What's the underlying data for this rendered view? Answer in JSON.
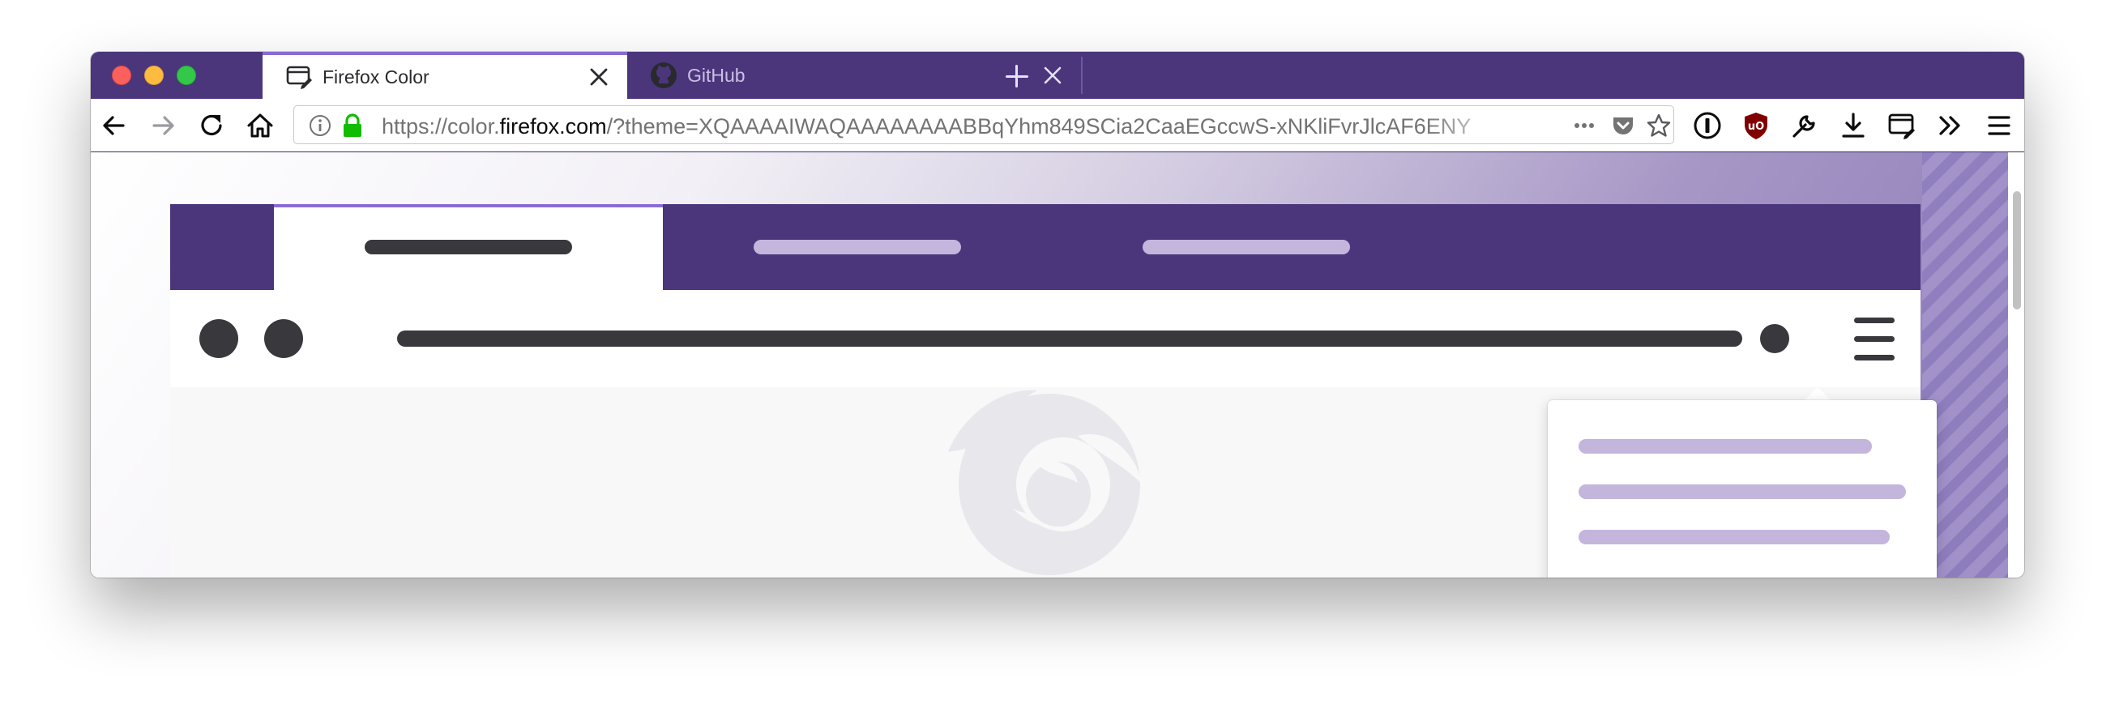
{
  "window": {
    "traffic_lights": [
      "close",
      "minimize",
      "maximize"
    ]
  },
  "tabs": [
    {
      "title": "Firefox Color",
      "icon": "firefox-color-icon",
      "active": true
    },
    {
      "title": "GitHub",
      "icon": "github-icon",
      "active": false
    }
  ],
  "navbar": {
    "buttons": [
      "back-icon",
      "forward-icon",
      "reload-icon",
      "home-icon"
    ],
    "url": {
      "prefix": "https://color.",
      "host": "firefox.com",
      "rest": "/?theme=XQAAAAIWAQAAAAAAAABBqYhm849SCia2CaaEGccwS-xNKliFvrJlcAF6ENY"
    },
    "toolbar_icons": [
      "page-actions-icon",
      "pocket-icon",
      "bookmark-star-icon",
      "onepassword-icon",
      "ublock-origin-icon",
      "developer-tools-icon",
      "downloads-icon",
      "firefox-color-extension-icon",
      "overflow-chevron-icon",
      "hamburger-menu-icon"
    ]
  },
  "colors": {
    "frame": "#4b367c",
    "tab_line": "#8a6cd1",
    "toolbar": "#ffffff",
    "tab_text_inactive": "#c9c0e4",
    "placeholder_light": "#c4b5dd",
    "placeholder_dark": "#38383d"
  }
}
